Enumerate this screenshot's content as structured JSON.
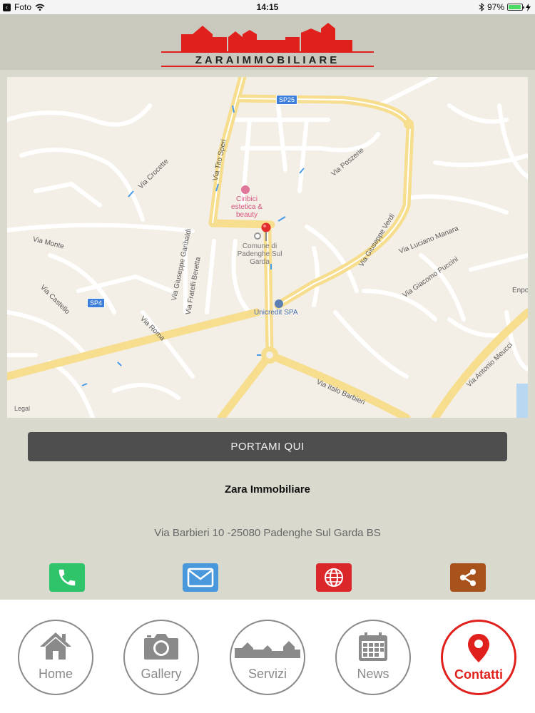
{
  "status_bar": {
    "back_app": "Foto",
    "time": "14:15",
    "battery": "97%",
    "battery_level": 0.97
  },
  "header": {
    "logo_text": "ZARAIMMOBILIARE",
    "brand_color": "#e0201c"
  },
  "map": {
    "road_badges": [
      "SP25",
      "SP4"
    ],
    "street_labels": {
      "tito_speri": "Via Tito Speri",
      "crocette": "Via Crocette",
      "poszerie": "Via Poszerie",
      "monte": "Via Monte",
      "garibaldi": "Via Giuseppe Garibaldi",
      "beretta": "Via Fratelli Beretta",
      "verdi": "Via Giuseppe Verdi",
      "manara": "Via Luciano Manara",
      "puccini": "Via Giacomo Puccini",
      "castello": "Via Castello",
      "roma": "Via Roma",
      "barbieri": "Via Italo Barbieri",
      "meucci": "Via Antonio Meucci"
    },
    "poi": {
      "ciribici": "Ciribici estetica & beauty",
      "comune": "Comune di Padenghe Sul Garda",
      "unicredit": "Unicredit SPA",
      "enpo": "Enpo"
    },
    "legal": "Legal"
  },
  "button": {
    "label": "PORTAMI QUI"
  },
  "company": {
    "name": "Zara Immobiliare"
  },
  "address": "Via Barbieri 10 -25080 Padenghe Sul Garda BS",
  "actions": [
    {
      "icon": "phone-icon",
      "color": "#2fc36a"
    },
    {
      "icon": "mail-icon",
      "color": "#4a98dc"
    },
    {
      "icon": "globe-icon",
      "color": "#d9272a"
    },
    {
      "icon": "share-icon",
      "color": "#a8531c"
    }
  ],
  "tabs": [
    {
      "label": "Home",
      "icon": "home-icon"
    },
    {
      "label": "Gallery",
      "icon": "camera-icon"
    },
    {
      "label": "Servizi",
      "icon": "skyline-icon"
    },
    {
      "label": "News",
      "icon": "calendar-icon"
    },
    {
      "label": "Contatti",
      "icon": "map-pin-icon",
      "active": true
    }
  ]
}
